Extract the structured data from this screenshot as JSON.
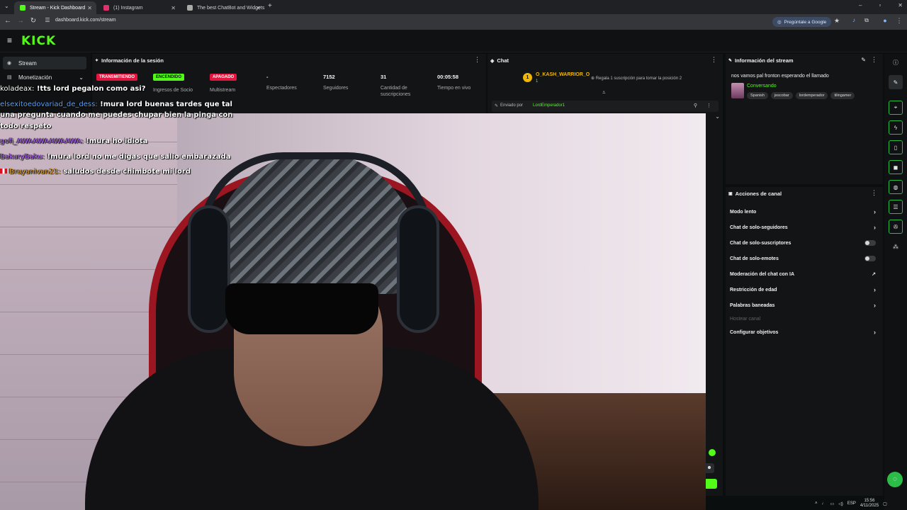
{
  "browser": {
    "tabs": [
      {
        "title": "Stream - Kick Dashboard",
        "favicon_color": "#53fc18",
        "active": true
      },
      {
        "title": "(1) Instagram",
        "favicon_color": "#e1306c",
        "active": false
      },
      {
        "title": "The best ChatBot and Widgets",
        "favicon_color": "#aaaaaa",
        "active": false
      }
    ],
    "url": "dashboard.kick.com/stream",
    "ask_google": "Pregúntale a Google"
  },
  "kick": {
    "logo": "KICK",
    "sidebar": [
      {
        "label": "Stream",
        "icon": "broadcast-icon",
        "glyph": "◉"
      },
      {
        "label": "Monetización",
        "icon": "money-icon",
        "glyph": "▤"
      }
    ]
  },
  "session": {
    "title": "Información de la sesión",
    "stats": [
      {
        "badge": "TRANSMITIENDO",
        "badge_color": "#e3163f",
        "label": ""
      },
      {
        "badge": "ENCENDIDO",
        "badge_color": "#53fc18",
        "label": "Ingresos de Socio"
      },
      {
        "badge": "APAGADO",
        "badge_color": "#e3163f",
        "label": "Multistream"
      },
      {
        "value": "-",
        "label": "Espectadores"
      },
      {
        "value": "7152",
        "label": "Seguidores"
      },
      {
        "value": "31",
        "label": "Cantidad de suscripciones"
      },
      {
        "value": "00:05:58",
        "label": "Tiempo en vivo"
      }
    ]
  },
  "chat": {
    "title": "Chat",
    "top_gifter": {
      "rank": "1",
      "name": "O_KASH_WARRIOR_O",
      "count": "1",
      "prompt": "Regala 1 suscripción para tomar la posición 2"
    },
    "pinned_by_label": "Enviado por",
    "pinned_by": "LordEmperador1"
  },
  "stream_info": {
    "title": "Información del stream",
    "stream_title": "nos vamos pal fronton esperando el llamado",
    "category": "Conversando",
    "tags": [
      "Spanish",
      "jescobar",
      "lordemperador",
      "tilingamer"
    ]
  },
  "actions": {
    "title": "Acciones de canal",
    "items": [
      {
        "label": "Modo lento",
        "control": "chevron"
      },
      {
        "label": "Chat de solo-seguidores",
        "control": "chevron"
      },
      {
        "label": "Chat de solo-suscriptores",
        "control": "toggle"
      },
      {
        "label": "Chat de solo-emotes",
        "control": "toggle"
      },
      {
        "label": "Moderación del chat con IA",
        "control": "external"
      },
      {
        "label": "Restricción de edad",
        "control": "chevron"
      },
      {
        "label": "Palabras baneadas",
        "control": "chevron"
      },
      {
        "label": "Hostear canal",
        "control": "none"
      },
      {
        "label": "Configurar objetivos",
        "control": "chevron"
      }
    ]
  },
  "overlay_chat": [
    {
      "user": "koladeax:",
      "user_color": "#ffffff",
      "message": "!tts lord pegalon como asi?"
    },
    {
      "user": "elsexitoedovariad_de_dess:",
      "user_color": "#5aa0ff",
      "message": "!mura lord buenas tardes que tal una pregunta cuando me puedes chupar bien la pinga con todo respeto"
    },
    {
      "user": "gofi_AWAAWAAWAAWA:",
      "user_color": "#b05cff",
      "message": "!mura ho idiota"
    },
    {
      "user": "BakuryBaku:",
      "user_color": "#b05cff",
      "message": "!mura lord no me digas que salio embarazada"
    },
    {
      "user": "Brayanivan21:",
      "user_color": "#e0a030",
      "message": "saludos desde chimbote mi lord"
    }
  ],
  "taskbar": {
    "lang": "ESP",
    "time": "15:56",
    "date": "4/11/2025"
  }
}
